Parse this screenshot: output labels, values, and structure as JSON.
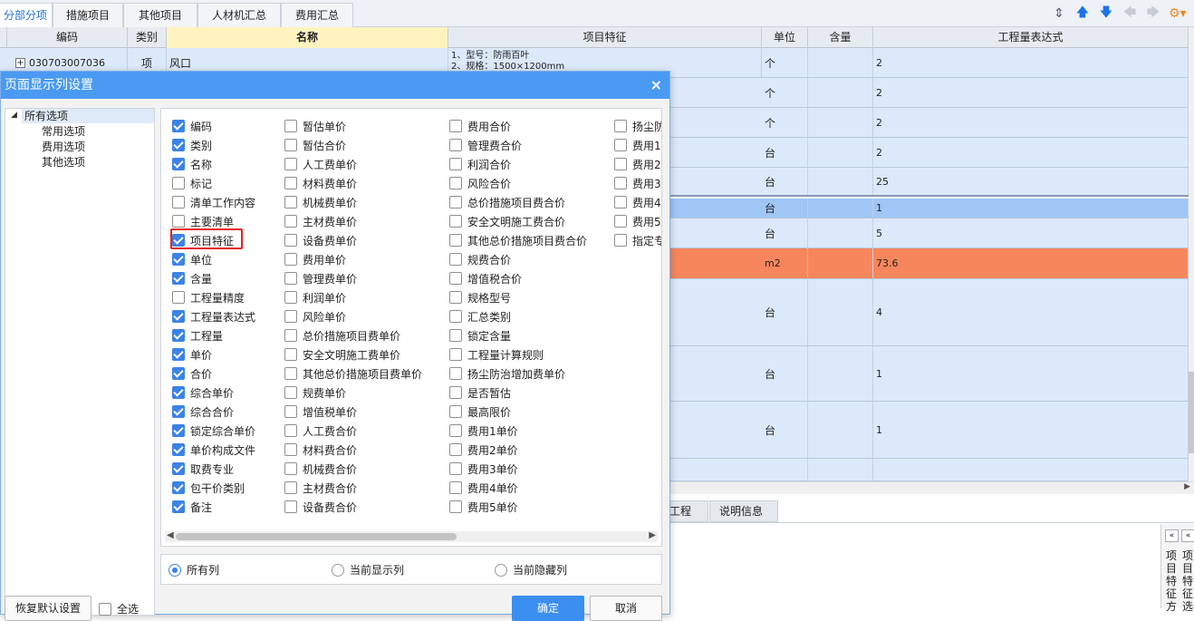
{
  "tabs": [
    "分部分项",
    "措施项目",
    "其他项目",
    "人材机汇总",
    "费用汇总"
  ],
  "toolbar_icons": [
    "reorder-icon",
    "arrow-up-icon",
    "arrow-down-icon",
    "arrow-left-icon",
    "arrow-right-icon",
    "settings-icon"
  ],
  "grid": {
    "headers": [
      "编码",
      "类别",
      "名称",
      "项目特征",
      "单位",
      "含量",
      "工程量表达式"
    ],
    "first_row": {
      "code": "030703007036",
      "type": "项",
      "name": "风口",
      "feature": "1、型号：防雨百叶\n2、规格：1500×1200mm",
      "unit": "个",
      "qty": "2"
    },
    "rows": [
      {
        "unit": "个",
        "expr": "2"
      },
      {
        "unit": "个",
        "expr": "2"
      },
      {
        "unit": "台",
        "expr": "2"
      },
      {
        "unit": "台",
        "expr": "25"
      },
      {
        "unit": "台",
        "expr": "1"
      },
      {
        "unit": "台",
        "expr": "5"
      },
      {
        "unit": "m2",
        "expr": "73.6"
      },
      {
        "unit": "台",
        "expr": "4"
      },
      {
        "unit": "台",
        "expr": "1"
      },
      {
        "unit": "台",
        "expr": "1"
      }
    ]
  },
  "bottom_tabs": [
    "工程量",
    "说明信息"
  ],
  "side_panel": {
    "text1": "项目特征方",
    "text2": "项目特征选"
  },
  "dialog": {
    "title": "页面显示列设置",
    "close": "×",
    "tree": {
      "root": "所有选项",
      "children": [
        "常用选项",
        "费用选项",
        "其他选项"
      ]
    },
    "columns": [
      [
        {
          "label": "编码",
          "checked": true
        },
        {
          "label": "类别",
          "checked": true
        },
        {
          "label": "名称",
          "checked": true
        },
        {
          "label": "标记",
          "checked": false
        },
        {
          "label": "清单工作内容",
          "checked": false
        },
        {
          "label": "主要清单",
          "checked": false
        },
        {
          "label": "项目特征",
          "checked": true
        },
        {
          "label": "单位",
          "checked": true
        },
        {
          "label": "含量",
          "checked": true
        },
        {
          "label": "工程量精度",
          "checked": false
        },
        {
          "label": "工程量表达式",
          "checked": true
        },
        {
          "label": "工程量",
          "checked": true
        },
        {
          "label": "单价",
          "checked": true
        },
        {
          "label": "合价",
          "checked": true
        },
        {
          "label": "综合单价",
          "checked": true
        },
        {
          "label": "综合合价",
          "checked": true
        },
        {
          "label": "锁定综合单价",
          "checked": true
        },
        {
          "label": "单价构成文件",
          "checked": true
        },
        {
          "label": "取费专业",
          "checked": true
        },
        {
          "label": "包干价类别",
          "checked": true
        },
        {
          "label": "备注",
          "checked": true
        }
      ],
      [
        {
          "label": "暂估单价",
          "checked": false
        },
        {
          "label": "暂估合价",
          "checked": false
        },
        {
          "label": "人工费单价",
          "checked": false
        },
        {
          "label": "材料费单价",
          "checked": false
        },
        {
          "label": "机械费单价",
          "checked": false
        },
        {
          "label": "主材费单价",
          "checked": false
        },
        {
          "label": "设备费单价",
          "checked": false
        },
        {
          "label": "费用单价",
          "checked": false
        },
        {
          "label": "管理费单价",
          "checked": false
        },
        {
          "label": "利润单价",
          "checked": false
        },
        {
          "label": "风险单价",
          "checked": false
        },
        {
          "label": "总价措施项目费单价",
          "checked": false
        },
        {
          "label": "安全文明施工费单价",
          "checked": false
        },
        {
          "label": "其他总价措施项目费单价",
          "checked": false
        },
        {
          "label": "规费单价",
          "checked": false
        },
        {
          "label": "增值税单价",
          "checked": false
        },
        {
          "label": "人工费合价",
          "checked": false
        },
        {
          "label": "材料费合价",
          "checked": false
        },
        {
          "label": "机械费合价",
          "checked": false
        },
        {
          "label": "主材费合价",
          "checked": false
        },
        {
          "label": "设备费合价",
          "checked": false
        }
      ],
      [
        {
          "label": "费用合价",
          "checked": false
        },
        {
          "label": "管理费合价",
          "checked": false
        },
        {
          "label": "利润合价",
          "checked": false
        },
        {
          "label": "风险合价",
          "checked": false
        },
        {
          "label": "总价措施项目费合价",
          "checked": false
        },
        {
          "label": "安全文明施工费合价",
          "checked": false
        },
        {
          "label": "其他总价措施项目费合价",
          "checked": false
        },
        {
          "label": "规费合价",
          "checked": false
        },
        {
          "label": "增值税合价",
          "checked": false
        },
        {
          "label": "规格型号",
          "checked": false
        },
        {
          "label": "汇总类别",
          "checked": false
        },
        {
          "label": "锁定含量",
          "checked": false
        },
        {
          "label": "工程量计算规则",
          "checked": false
        },
        {
          "label": "扬尘防治增加费单价",
          "checked": false
        },
        {
          "label": "是否暂估",
          "checked": false
        },
        {
          "label": "最高限价",
          "checked": false
        },
        {
          "label": "费用1单价",
          "checked": false
        },
        {
          "label": "费用2单价",
          "checked": false
        },
        {
          "label": "费用3单价",
          "checked": false
        },
        {
          "label": "费用4单价",
          "checked": false
        },
        {
          "label": "费用5单价",
          "checked": false
        }
      ],
      [
        {
          "label": "扬尘防",
          "checked": false
        },
        {
          "label": "费用1",
          "checked": false
        },
        {
          "label": "费用2",
          "checked": false
        },
        {
          "label": "费用3",
          "checked": false
        },
        {
          "label": "费用4",
          "checked": false
        },
        {
          "label": "费用5",
          "checked": false
        },
        {
          "label": "指定专",
          "checked": false
        }
      ]
    ],
    "radios": [
      {
        "label": "所有列",
        "checked": true
      },
      {
        "label": "当前显示列",
        "checked": false
      },
      {
        "label": "当前隐藏列",
        "checked": false
      }
    ],
    "restore_label": "恢复默认设置",
    "select_all_label": "全选",
    "ok_label": "确定",
    "cancel_label": "取消"
  }
}
